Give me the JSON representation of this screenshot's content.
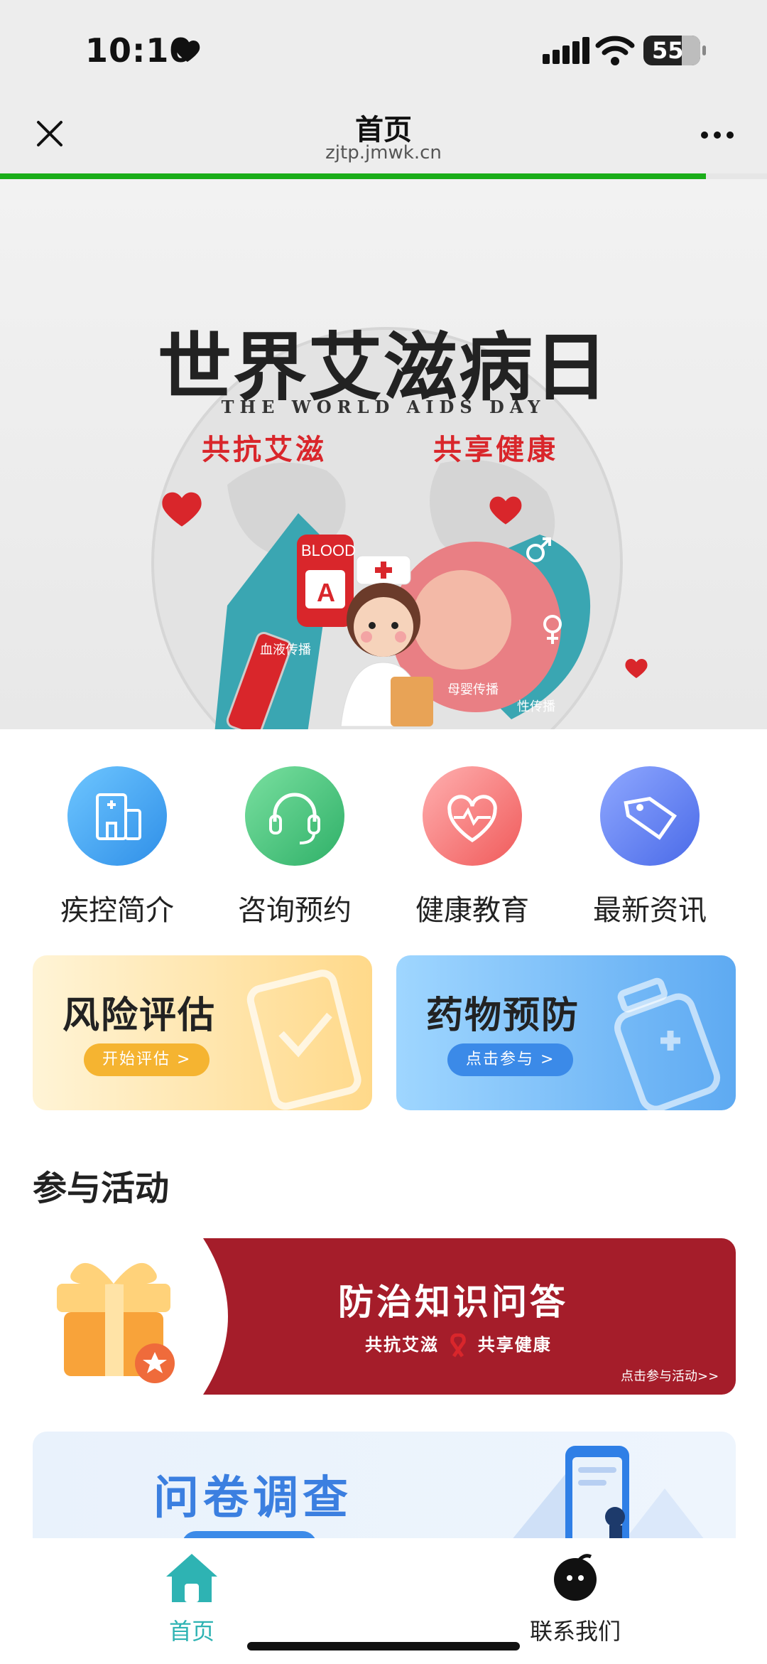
{
  "status_bar": {
    "time": "10:10",
    "battery": "55"
  },
  "nav": {
    "title": "首页",
    "url": "zjtp.jmwk.cn"
  },
  "page_progress": 0.92,
  "banner": {
    "title": "世界艾滋病日",
    "subtitle": "THE WORLD AIDS DAY",
    "slogan_left": "共抗艾滋",
    "slogan_right": "共享健康",
    "label_blood": "血液传播",
    "label_mother": "母婴传播",
    "label_sex": "性传播",
    "bag_text": "BLOOD",
    "bag_letter": "A"
  },
  "quick_icons": [
    {
      "label": "疾控简介",
      "icon": "hospital-icon",
      "color": "#3aa0f0"
    },
    {
      "label": "咨询预约",
      "icon": "headset-icon",
      "color": "#3dc07a"
    },
    {
      "label": "健康教育",
      "icon": "heart-pulse-icon",
      "color": "#f26d6d"
    },
    {
      "label": "最新资讯",
      "icon": "tag-icon",
      "color": "#5a7ef0"
    }
  ],
  "cards": [
    {
      "title": "风险评估",
      "button": "开始评估 >"
    },
    {
      "title": "药物预防",
      "button": "点击参与 >"
    }
  ],
  "section": {
    "title": "参与活动"
  },
  "quiz": {
    "title": "防治知识问答",
    "subtitle_left": "共抗艾滋",
    "subtitle_right": "共享健康",
    "link": "点击参与活动>>"
  },
  "survey": {
    "title": "问卷调查"
  },
  "tabbar": {
    "home": "首页",
    "contact": "联系我们"
  }
}
